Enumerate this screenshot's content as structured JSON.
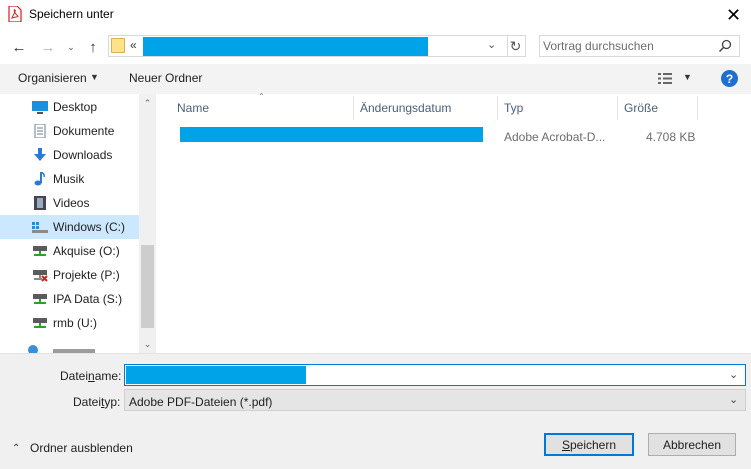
{
  "window": {
    "title": "Speichern unter",
    "close_glyph": "✕"
  },
  "nav": {
    "back_glyph": "←",
    "forward_glyph": "→",
    "recent_glyph": "⌄",
    "up_glyph": "↑",
    "path_prefix": "«",
    "refresh_glyph": "↻",
    "dropdown_glyph": "⌄",
    "search_placeholder": "Vortrag durchsuchen"
  },
  "toolbar": {
    "organize_label": "Organisieren",
    "new_folder_label": "Neuer Ordner",
    "caret_glyph": "▼",
    "help_glyph": "?"
  },
  "sidebar": {
    "items": [
      {
        "label": "Desktop",
        "icon": "desktop-icon"
      },
      {
        "label": "Dokumente",
        "icon": "documents-icon"
      },
      {
        "label": "Downloads",
        "icon": "downloads-icon"
      },
      {
        "label": "Musik",
        "icon": "music-icon"
      },
      {
        "label": "Videos",
        "icon": "videos-icon"
      },
      {
        "label": "Windows (C:)",
        "icon": "drive-icon",
        "selected": true
      },
      {
        "label": "Akquise (O:)",
        "icon": "network-drive-icon"
      },
      {
        "label": "Projekte (P:)",
        "icon": "disconnected-drive-icon"
      },
      {
        "label": "IPA Data (S:)",
        "icon": "network-drive-icon"
      },
      {
        "label": "rmb (U:)",
        "icon": "network-drive-icon"
      }
    ],
    "scroll_up_glyph": "⌃",
    "scroll_down_glyph": "⌄"
  },
  "file_list": {
    "sort_glyph": "⌃",
    "columns": [
      "Name",
      "Änderungsdatum",
      "Typ",
      "Größe"
    ],
    "rows": [
      {
        "type": "Adobe Acrobat-D...",
        "size": "4.708 KB"
      }
    ]
  },
  "form": {
    "filename_label_pre": "Datei",
    "filename_label_ul": "n",
    "filename_label_post": "ame:",
    "filetype_label_pre": "Datei",
    "filetype_label_ul": "t",
    "filetype_label_post": "yp:",
    "filetype_value": "Adobe PDF-Dateien (*.pdf)",
    "dropdown_glyph": "⌄",
    "hide_folders_glyph": "⌃",
    "hide_folders_label": "Ordner ausblenden",
    "save_ul": "S",
    "save_rest": "peichern",
    "cancel_label": "Abbrechen"
  },
  "colors": {
    "accent": "#0078d7",
    "redaction": "#00a2e8",
    "selection": "#cce8ff"
  }
}
